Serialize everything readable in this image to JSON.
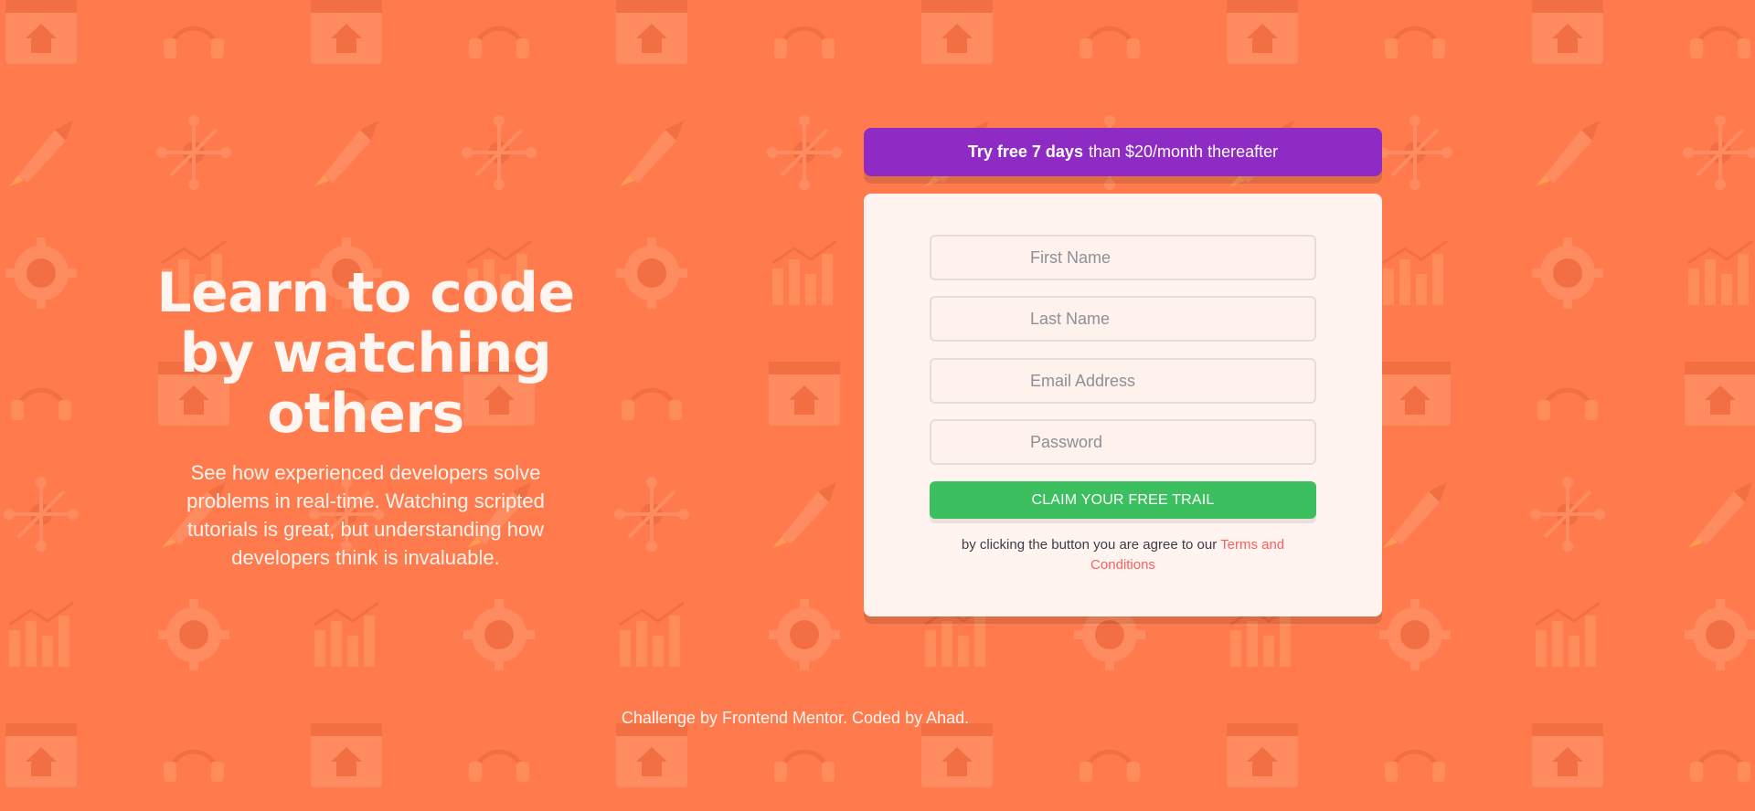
{
  "hero": {
    "title": "Learn to code by watching others",
    "description": "See how experienced developers solve problems in real-time. Watching scripted tutorials is great, but understanding how developers think is invaluable."
  },
  "promo": {
    "bold": "Try free 7 days",
    "rest": "than $20/month thereafter"
  },
  "form": {
    "first_name_placeholder": "First Name",
    "last_name_placeholder": "Last Name",
    "email_placeholder": "Email Address",
    "password_placeholder": "Password",
    "submit_label": "Claim your free trail",
    "terms_prefix": "by clicking the button you are agree to our",
    "terms_link": "Terms and Conditions"
  },
  "footer": {
    "text": "Challenge by Frontend Mentor. Coded by Ahad."
  },
  "colors": {
    "background": "#ff7b4e",
    "promo": "#8e2bc4",
    "cta": "#3bbf5f",
    "link": "#ff5d5d"
  }
}
